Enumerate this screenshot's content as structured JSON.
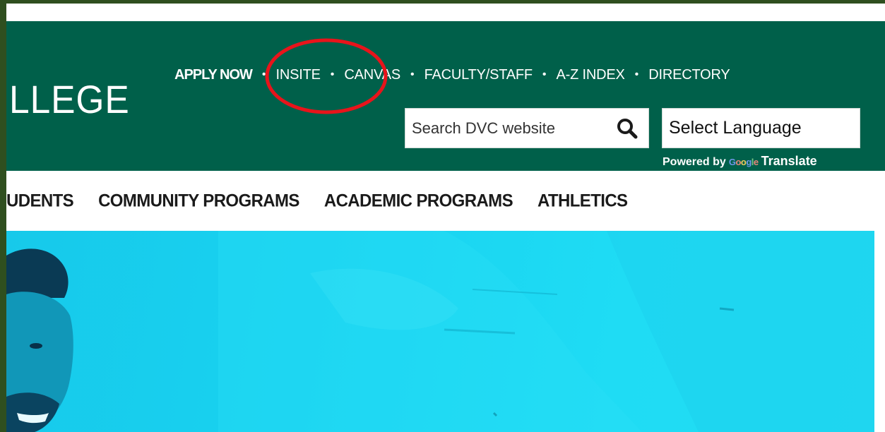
{
  "header": {
    "college_fragment": "LLEGE",
    "utility_nav": [
      {
        "label": "APPLY NOW",
        "bold": true
      },
      {
        "label": "INSITE",
        "bold": false
      },
      {
        "label": "CANVAS",
        "bold": false
      },
      {
        "label": "FACULTY/STAFF",
        "bold": false
      },
      {
        "label": "A-Z INDEX",
        "bold": false
      },
      {
        "label": "DIRECTORY",
        "bold": false
      }
    ],
    "separator": "•",
    "search": {
      "placeholder": "Search DVC website",
      "icon": "search-icon"
    },
    "language": {
      "label": "Select Language"
    },
    "powered_by": {
      "prefix": "Powered by",
      "brand": "Google",
      "suffix": "Translate"
    }
  },
  "main_nav": {
    "items": [
      "UDENTS",
      "COMMUNITY PROGRAMS",
      "ACADEMIC PROGRAMS",
      "ATHLETICS"
    ]
  },
  "annotation": {
    "shape": "ellipse",
    "color": "#e8141b",
    "target": "INSITE"
  },
  "colors": {
    "header_bg": "#00604a",
    "frame": "#2f4f1f",
    "hero_cyan": "#18d2f0",
    "nav_text": "#1a1a1a"
  }
}
